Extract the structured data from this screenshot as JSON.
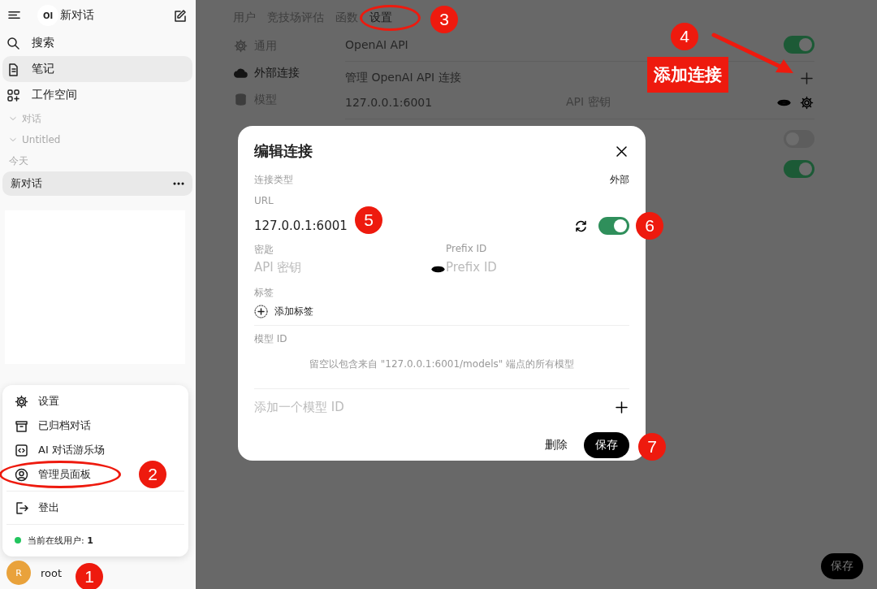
{
  "sidebar": {
    "logo": "OI",
    "title": "新对话",
    "nav": [
      {
        "label": "搜索",
        "selected": false
      },
      {
        "label": "笔记",
        "selected": true
      },
      {
        "label": "工作空间",
        "selected": false
      }
    ],
    "folders": [
      {
        "label": "对话",
        "expanded": true
      },
      {
        "label": "Untitled",
        "expanded": true
      }
    ],
    "groups": [
      {
        "label": "今天",
        "chats": [
          {
            "title": "新对话",
            "selected": true
          }
        ]
      }
    ],
    "menu": {
      "items": [
        {
          "label": "设置"
        },
        {
          "label": "已归档对话"
        },
        {
          "label": "AI 对话游乐场"
        },
        {
          "label": "管理员面板",
          "marker": {
            "number": "2",
            "ring": true
          }
        },
        {
          "label": "登出",
          "divider_before": true
        }
      ],
      "status": {
        "text": "当前在线用户: **1**",
        "color": "#22c55e"
      }
    },
    "user": {
      "initial": "R",
      "name": "root",
      "marker": {
        "number": "1"
      }
    }
  },
  "settings": {
    "tabs": [
      {
        "label": "用户",
        "selected": false
      },
      {
        "label": "竞技场评估",
        "selected": false
      },
      {
        "label": "函数",
        "selected": false
      },
      {
        "label": "设置",
        "selected": true,
        "marker": {
          "number": "3",
          "ring": true
        }
      }
    ],
    "nav": [
      {
        "label": "通用",
        "selected": false
      },
      {
        "label": "外部连接",
        "selected": true
      },
      {
        "label": "模型",
        "selected": false
      }
    ],
    "openai": {
      "label": "OpenAI API",
      "on": true
    },
    "manage": {
      "label": "管理 OpenAI API 连接",
      "marker": {
        "number": "4",
        "callout": "添加连接"
      }
    },
    "connections": [
      {
        "url": "127.0.0.1:6001",
        "key_placeholder": "API 密钥"
      }
    ],
    "more_toggles": [
      {
        "on": false
      },
      {
        "on": true
      }
    ],
    "save": "保存"
  },
  "dialog": {
    "title": "编辑连接",
    "type_label": "连接类型",
    "type_value": "外部",
    "url_label": "URL",
    "url": "127.0.0.1:6001",
    "url_marker": {
      "number": "5"
    },
    "enabled": true,
    "toggle_marker": {
      "number": "6"
    },
    "key_label": "密匙",
    "key_placeholder": "API 密钥",
    "prefix_label": "Prefix ID",
    "prefix_placeholder": "Prefix ID",
    "tags_label": "标签",
    "add_tag": "添加标签",
    "model_label": "模型 ID",
    "model_hint": "留空以包含来自 \"127.0.0.1:6001/models\" 端点的所有模型",
    "model_placeholder": "添加一个模型 ID",
    "delete": "删除",
    "save": "保存",
    "save_marker": {
      "number": "7"
    }
  }
}
